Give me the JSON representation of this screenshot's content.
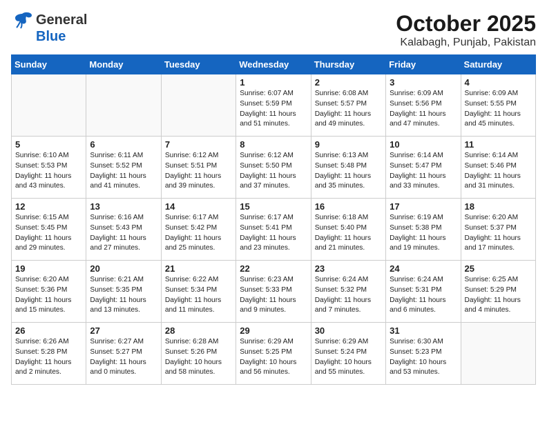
{
  "header": {
    "logo": {
      "general": "General",
      "blue": "Blue"
    },
    "title": "October 2025",
    "subtitle": "Kalabagh, Punjab, Pakistan"
  },
  "days_of_week": [
    "Sunday",
    "Monday",
    "Tuesday",
    "Wednesday",
    "Thursday",
    "Friday",
    "Saturday"
  ],
  "weeks": [
    [
      {
        "num": "",
        "info": ""
      },
      {
        "num": "",
        "info": ""
      },
      {
        "num": "",
        "info": ""
      },
      {
        "num": "1",
        "info": "Sunrise: 6:07 AM\nSunset: 5:59 PM\nDaylight: 11 hours\nand 51 minutes."
      },
      {
        "num": "2",
        "info": "Sunrise: 6:08 AM\nSunset: 5:57 PM\nDaylight: 11 hours\nand 49 minutes."
      },
      {
        "num": "3",
        "info": "Sunrise: 6:09 AM\nSunset: 5:56 PM\nDaylight: 11 hours\nand 47 minutes."
      },
      {
        "num": "4",
        "info": "Sunrise: 6:09 AM\nSunset: 5:55 PM\nDaylight: 11 hours\nand 45 minutes."
      }
    ],
    [
      {
        "num": "5",
        "info": "Sunrise: 6:10 AM\nSunset: 5:53 PM\nDaylight: 11 hours\nand 43 minutes."
      },
      {
        "num": "6",
        "info": "Sunrise: 6:11 AM\nSunset: 5:52 PM\nDaylight: 11 hours\nand 41 minutes."
      },
      {
        "num": "7",
        "info": "Sunrise: 6:12 AM\nSunset: 5:51 PM\nDaylight: 11 hours\nand 39 minutes."
      },
      {
        "num": "8",
        "info": "Sunrise: 6:12 AM\nSunset: 5:50 PM\nDaylight: 11 hours\nand 37 minutes."
      },
      {
        "num": "9",
        "info": "Sunrise: 6:13 AM\nSunset: 5:48 PM\nDaylight: 11 hours\nand 35 minutes."
      },
      {
        "num": "10",
        "info": "Sunrise: 6:14 AM\nSunset: 5:47 PM\nDaylight: 11 hours\nand 33 minutes."
      },
      {
        "num": "11",
        "info": "Sunrise: 6:14 AM\nSunset: 5:46 PM\nDaylight: 11 hours\nand 31 minutes."
      }
    ],
    [
      {
        "num": "12",
        "info": "Sunrise: 6:15 AM\nSunset: 5:45 PM\nDaylight: 11 hours\nand 29 minutes."
      },
      {
        "num": "13",
        "info": "Sunrise: 6:16 AM\nSunset: 5:43 PM\nDaylight: 11 hours\nand 27 minutes."
      },
      {
        "num": "14",
        "info": "Sunrise: 6:17 AM\nSunset: 5:42 PM\nDaylight: 11 hours\nand 25 minutes."
      },
      {
        "num": "15",
        "info": "Sunrise: 6:17 AM\nSunset: 5:41 PM\nDaylight: 11 hours\nand 23 minutes."
      },
      {
        "num": "16",
        "info": "Sunrise: 6:18 AM\nSunset: 5:40 PM\nDaylight: 11 hours\nand 21 minutes."
      },
      {
        "num": "17",
        "info": "Sunrise: 6:19 AM\nSunset: 5:38 PM\nDaylight: 11 hours\nand 19 minutes."
      },
      {
        "num": "18",
        "info": "Sunrise: 6:20 AM\nSunset: 5:37 PM\nDaylight: 11 hours\nand 17 minutes."
      }
    ],
    [
      {
        "num": "19",
        "info": "Sunrise: 6:20 AM\nSunset: 5:36 PM\nDaylight: 11 hours\nand 15 minutes."
      },
      {
        "num": "20",
        "info": "Sunrise: 6:21 AM\nSunset: 5:35 PM\nDaylight: 11 hours\nand 13 minutes."
      },
      {
        "num": "21",
        "info": "Sunrise: 6:22 AM\nSunset: 5:34 PM\nDaylight: 11 hours\nand 11 minutes."
      },
      {
        "num": "22",
        "info": "Sunrise: 6:23 AM\nSunset: 5:33 PM\nDaylight: 11 hours\nand 9 minutes."
      },
      {
        "num": "23",
        "info": "Sunrise: 6:24 AM\nSunset: 5:32 PM\nDaylight: 11 hours\nand 7 minutes."
      },
      {
        "num": "24",
        "info": "Sunrise: 6:24 AM\nSunset: 5:31 PM\nDaylight: 11 hours\nand 6 minutes."
      },
      {
        "num": "25",
        "info": "Sunrise: 6:25 AM\nSunset: 5:29 PM\nDaylight: 11 hours\nand 4 minutes."
      }
    ],
    [
      {
        "num": "26",
        "info": "Sunrise: 6:26 AM\nSunset: 5:28 PM\nDaylight: 11 hours\nand 2 minutes."
      },
      {
        "num": "27",
        "info": "Sunrise: 6:27 AM\nSunset: 5:27 PM\nDaylight: 11 hours\nand 0 minutes."
      },
      {
        "num": "28",
        "info": "Sunrise: 6:28 AM\nSunset: 5:26 PM\nDaylight: 10 hours\nand 58 minutes."
      },
      {
        "num": "29",
        "info": "Sunrise: 6:29 AM\nSunset: 5:25 PM\nDaylight: 10 hours\nand 56 minutes."
      },
      {
        "num": "30",
        "info": "Sunrise: 6:29 AM\nSunset: 5:24 PM\nDaylight: 10 hours\nand 55 minutes."
      },
      {
        "num": "31",
        "info": "Sunrise: 6:30 AM\nSunset: 5:23 PM\nDaylight: 10 hours\nand 53 minutes."
      },
      {
        "num": "",
        "info": ""
      }
    ]
  ]
}
